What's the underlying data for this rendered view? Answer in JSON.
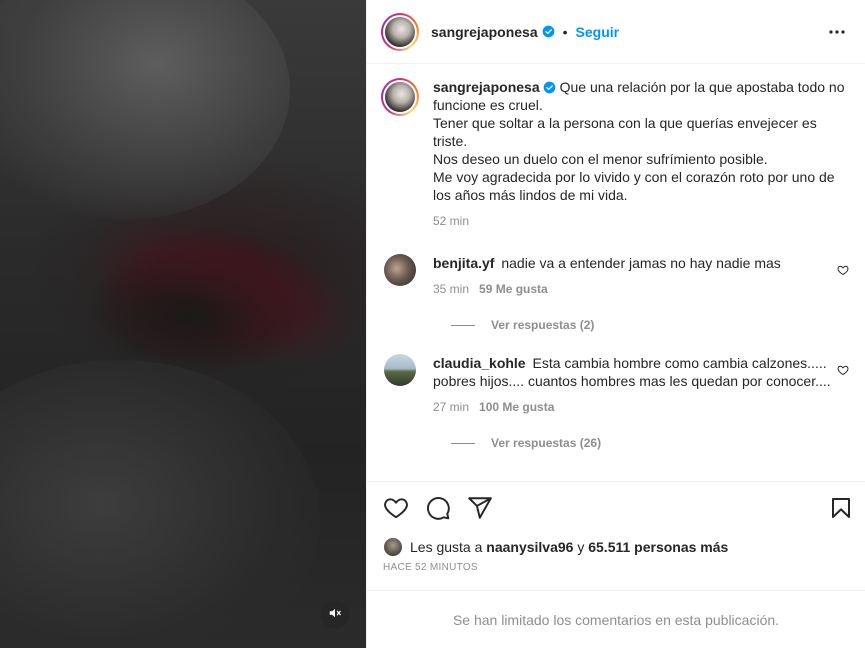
{
  "post": {
    "username": "sangrejaponesa",
    "follow_label": "Seguir",
    "separator": "•",
    "caption_lines": [
      "Que una relación por la que apostaba todo no funcione es cruel.",
      "Tener que soltar a la persona con la que querías envejecer es triste.",
      "Nos deseo un duelo con el menor sufrímiento posible.",
      "Me voy agradecida por lo vivido y con el corazón roto por uno de los años más lindos de mi vida."
    ],
    "caption_time": "52 min"
  },
  "comments": [
    {
      "username": "benjita.yf",
      "text": "nadie va a entender jamas no hay nadie mas",
      "time": "35 min",
      "likes": "59 Me gusta",
      "replies": "Ver respuestas (2)"
    },
    {
      "username": "claudia_kohle",
      "text": "Esta cambia hombre como cambia calzones..... pobres hijos.... cuantos hombres mas les quedan por conocer....",
      "time": "27 min",
      "likes": "100 Me gusta",
      "replies": "Ver respuestas (26)"
    }
  ],
  "likes_summary": {
    "prefix": "Les gusta a",
    "user": "naanysilva96",
    "joiner": "y",
    "others": "65.511 personas más"
  },
  "posted_ago": "HACE 52 MINUTOS",
  "comments_limited": "Se han limitado los comentarios en esta publicación.",
  "icons": [
    "verified-badge",
    "more-options-icon",
    "heart-icon",
    "comment-icon",
    "share-icon",
    "bookmark-icon",
    "mute-icon"
  ],
  "colors": {
    "link": "#0095f6",
    "muted": "#8e8e8e",
    "text": "#262626",
    "border": "#efefef"
  }
}
